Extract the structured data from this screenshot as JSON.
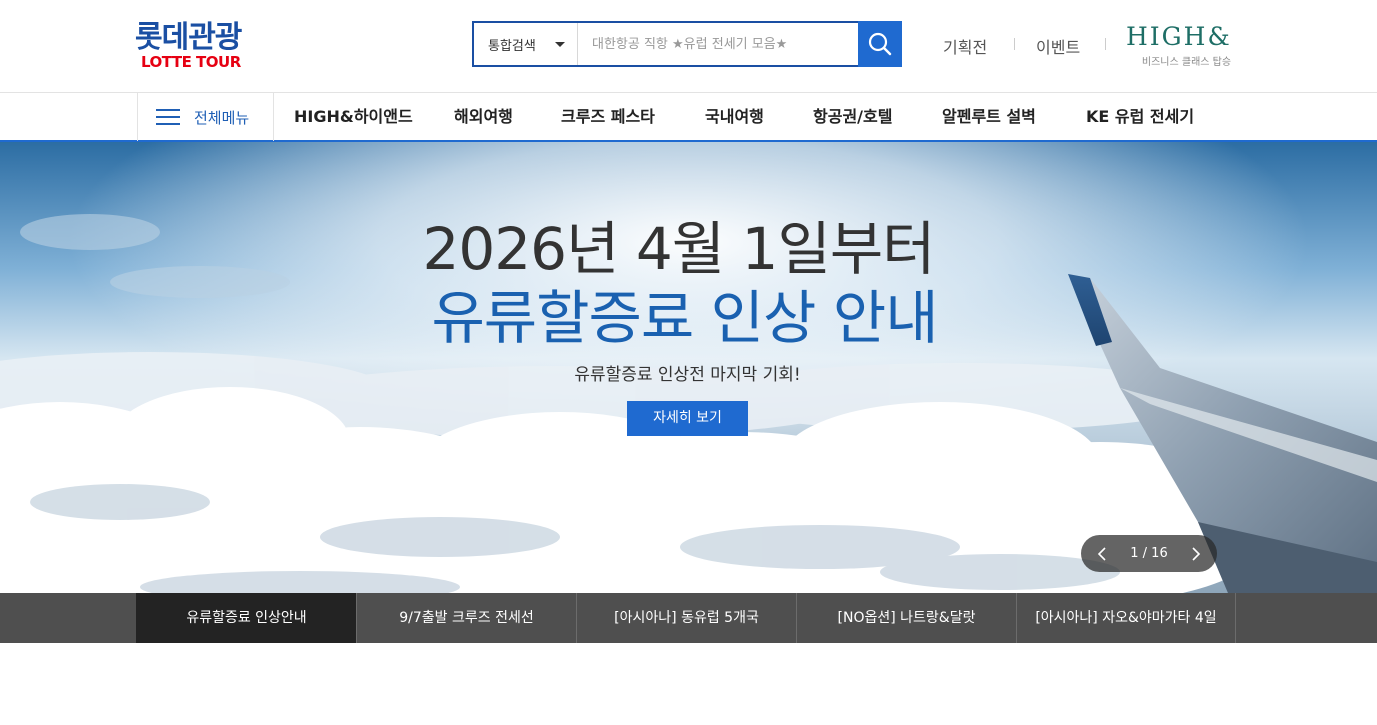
{
  "header": {
    "logo": {
      "korean": "롯데관광",
      "english": "LOTTE TOUR"
    },
    "search": {
      "category": "통합검색",
      "placeholder": "대한항공 직항 ★유럽 전세기 모음★",
      "search_icon": "search-icon"
    },
    "util_links": [
      "기획전",
      "이벤트"
    ],
    "highand": {
      "logo": "HIGH&",
      "sub": "비즈니스 클래스 탑승"
    }
  },
  "gnb": {
    "all_menu": {
      "label": "전체메뉴",
      "icon": "hamburger-icon"
    },
    "items": [
      "HIGH&하이앤드",
      "해외여행",
      "크루즈 페스타",
      "국내여행",
      "항공권/호텔",
      "알펜루트 설벽",
      "KE 유럽 전세기"
    ]
  },
  "hero": {
    "title_line1": "2026년 4월 1일부터",
    "title_line2": "유류할증료 인상 안내",
    "subtitle": "유류할증료 인상전 마지막 기회!",
    "button": "자세히 보기",
    "pager": {
      "current": 1,
      "total": 16,
      "text": "1 / 16",
      "prev_icon": "chevron-left-icon",
      "next_icon": "chevron-right-icon"
    }
  },
  "banner_tabs": [
    {
      "label": "유류할증료 인상안내",
      "active": true
    },
    {
      "label": "9/7출발 크루즈 전세선",
      "active": false
    },
    {
      "label": "[아시아나] 동유럽 5개국",
      "active": false
    },
    {
      "label": "[NO옵션] 나트랑&달랏",
      "active": false
    },
    {
      "label": "[아시아나] 자오&야마가타 4일",
      "active": false
    }
  ],
  "colors": {
    "brand_blue": "#1a4fa3",
    "accent_blue": "#1f6ad0",
    "brand_red": "#e60012",
    "highand_green": "#1e6e66",
    "tab_bar": "#4f4f4f",
    "tab_active": "#232323"
  }
}
